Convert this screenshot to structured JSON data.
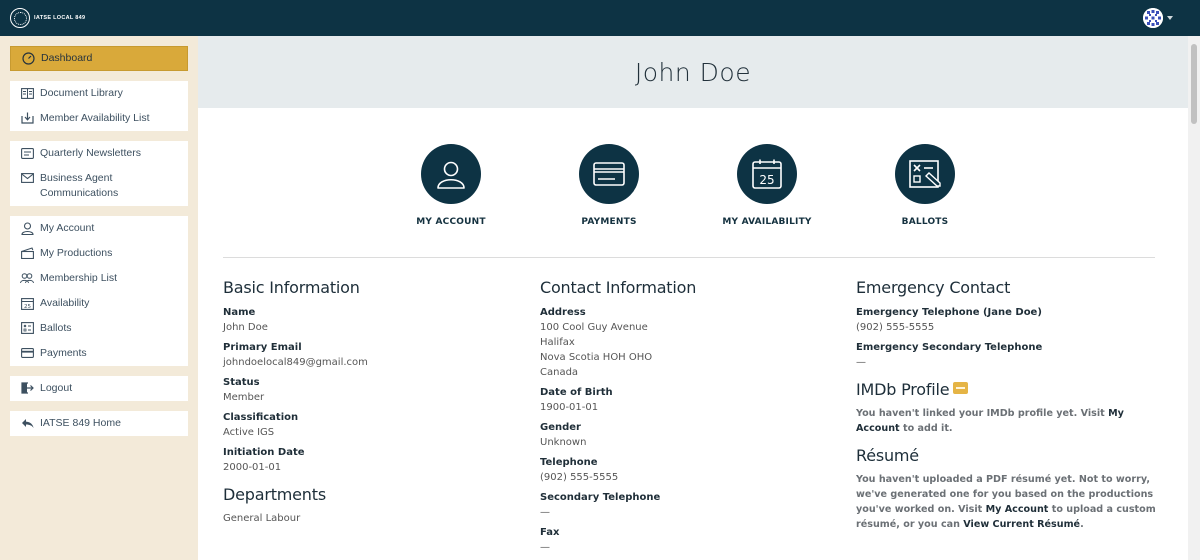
{
  "brand": {
    "logo_text": "IATSE LOCAL 849"
  },
  "sidebar": {
    "dashboard": "Dashboard",
    "group1": [
      "Document Library",
      "Member Availability List"
    ],
    "group2": [
      "Quarterly Newsletters",
      "Business Agent Communications"
    ],
    "group3": [
      "My Account",
      "My Productions",
      "Membership List",
      "Availability",
      "Ballots",
      "Payments"
    ],
    "logout": "Logout",
    "home": "IATSE 849 Home"
  },
  "profile": {
    "name": "John Doe"
  },
  "quick_links": [
    {
      "label": "MY ACCOUNT",
      "icon": "person-icon"
    },
    {
      "label": "PAYMENTS",
      "icon": "credit-card-icon"
    },
    {
      "label": "MY AVAILABILITY",
      "icon": "calendar-icon",
      "day": "25"
    },
    {
      "label": "BALLOTS",
      "icon": "ballot-icon"
    }
  ],
  "basic": {
    "title": "Basic Information",
    "name_label": "Name",
    "name": "John Doe",
    "email_label": "Primary Email",
    "email": "johndoelocal849@gmail.com",
    "status_label": "Status",
    "status": "Member",
    "class_label": "Classification",
    "class": "Active IGS",
    "init_label": "Initiation Date",
    "init": "2000-01-01"
  },
  "departments": {
    "title": "Departments",
    "value": "General Labour"
  },
  "contact": {
    "title": "Contact Information",
    "address_label": "Address",
    "address": [
      "100 Cool Guy Avenue",
      "Halifax",
      "Nova Scotia HOH OHO",
      "Canada"
    ],
    "dob_label": "Date of Birth",
    "dob": "1900-01-01",
    "gender_label": "Gender",
    "gender": "Unknown",
    "phone_label": "Telephone",
    "phone": "(902) 555-5555",
    "phone2_label": "Secondary Telephone",
    "phone2": "—",
    "fax_label": "Fax",
    "fax": "—"
  },
  "emergency": {
    "title": "Emergency Contact",
    "phone_label": "Emergency Telephone (Jane Doe)",
    "phone": "(902) 555-5555",
    "phone2_label": "Emergency Secondary Telephone",
    "phone2": "—"
  },
  "imdb": {
    "title": "IMDb Profile",
    "text_before": "You haven't linked your IMDb profile yet. Visit ",
    "link": "My Account",
    "text_after": " to add it."
  },
  "resume": {
    "title": "Résumé",
    "text_before": "You haven't uploaded a PDF résumé yet. Not to worry, we've generated one for you based on the productions you've worked on. Visit ",
    "link1": "My Account",
    "text_mid": " to upload a custom résumé, or you can ",
    "link2": "View Current Résumé",
    "text_after": "."
  },
  "colors": {
    "navy": "#0d3344",
    "accent": "#d9a93a",
    "sidebar_bg": "#f3ead9"
  }
}
